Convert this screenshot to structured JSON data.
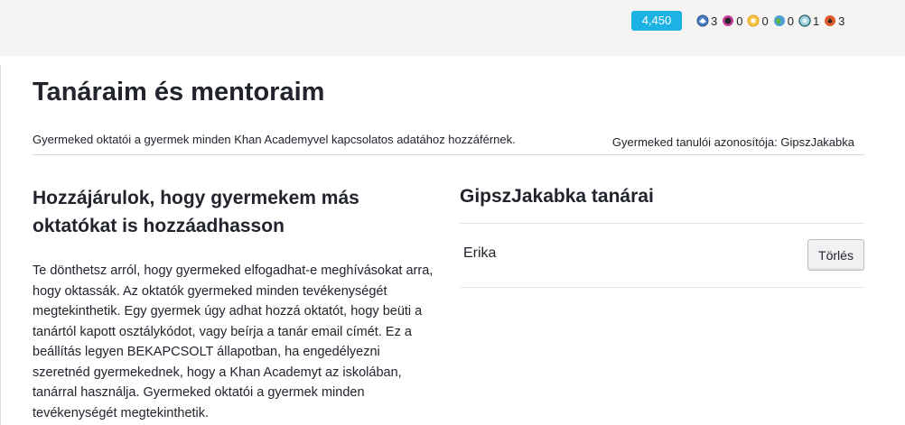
{
  "header": {
    "points": "4,450",
    "badges": [
      {
        "icon": "meteorite-badge-icon",
        "count": "3",
        "color": "#4a7dc9"
      },
      {
        "icon": "moon-badge-icon",
        "count": "0",
        "color": "#c83a9c"
      },
      {
        "icon": "earth-badge-icon",
        "count": "0",
        "color": "#f0b31f"
      },
      {
        "icon": "sun-badge-icon",
        "count": "0",
        "color": "#62b248"
      },
      {
        "icon": "black-hole-badge-icon",
        "count": "1",
        "color": "#5da7b5"
      },
      {
        "icon": "challenge-patch-icon",
        "count": "3",
        "color": "#e05a2c"
      }
    ]
  },
  "page": {
    "title": "Tanáraim és mentoraim",
    "subtitle": "Gyermeked oktatói a gyermek minden Khan Academyvel kapcsolatos adatához hozzáférnek.",
    "student_id": "Gyermeked tanulói azonosítója: GipszJakabka"
  },
  "consent": {
    "heading": "Hozzájárulok, hogy gyermekem más oktatókat is hozzáadhasson",
    "body": "Te dönthetsz arról, hogy gyermeked elfogadhat-e meghívásokat arra, hogy oktassák. Az oktatók gyermeked minden tevékenységét megtekinthetik. Egy gyermek úgy adhat hozzá oktatót, hogy beüti a tanártól kapott osztálykódot, vagy beírja a tanár email címét. Ez a beállítás legyen BEKAPCSOLT állapotban, ha engedélyezni szeretnéd gyermekednek, hogy a Khan Academyt az iskolában, tanárral használja. Gyermeked oktatói a gyermek minden tevékenységét megtekinthetik."
  },
  "teachers": {
    "heading": "GipszJakabka tanárai",
    "items": [
      {
        "name": "Erika",
        "delete_label": "Törlés"
      }
    ]
  }
}
